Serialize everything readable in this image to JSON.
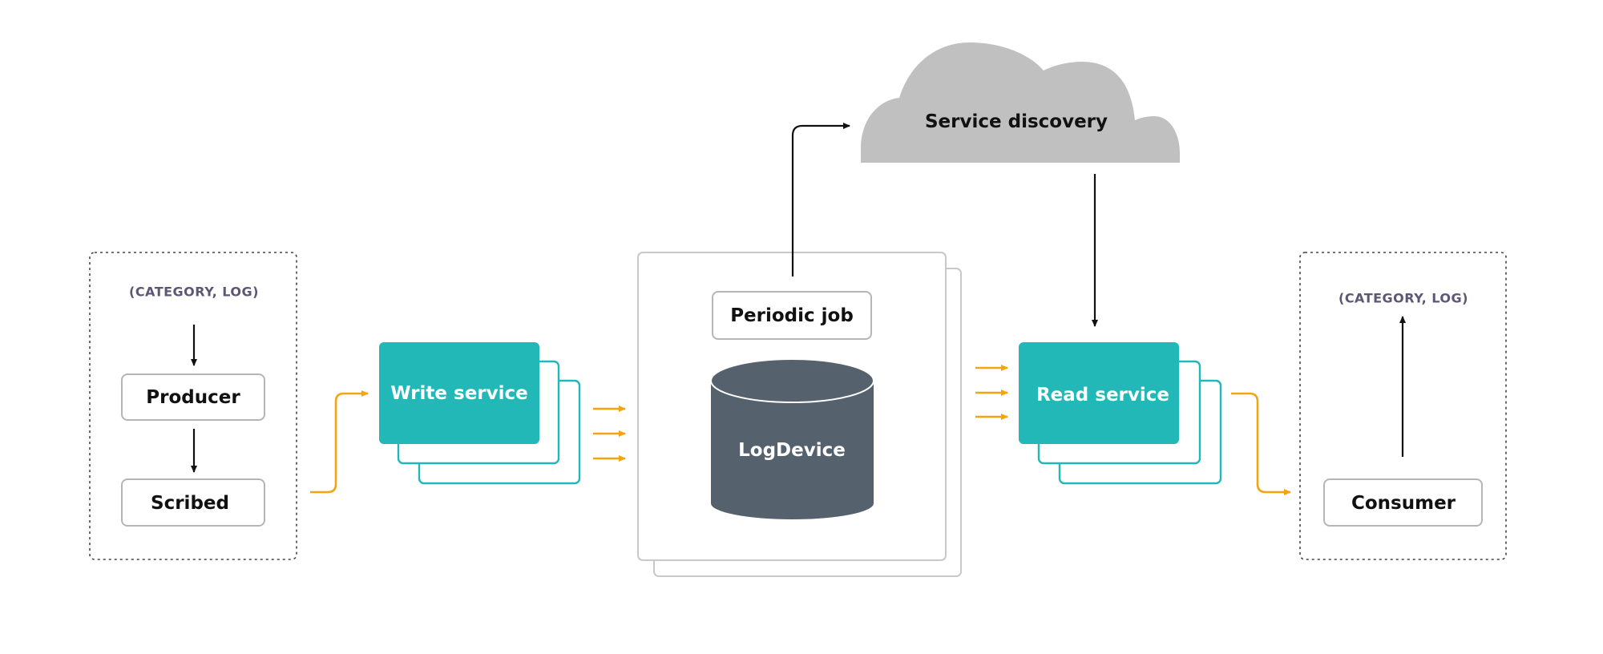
{
  "colors": {
    "service_teal": "#21b8b7",
    "flow_orange": "#f5a30f",
    "storage_slate": "#56616e",
    "cloud_gray": "#c0c0c0",
    "category_label": "#5e5677"
  },
  "producer_side": {
    "category_label": "(CATEGORY, LOG)",
    "producer": "Producer",
    "scribed": "Scribed"
  },
  "write_service": {
    "label": "Write service"
  },
  "storage": {
    "periodic_job": "Periodic job",
    "logdevice": "LogDevice"
  },
  "service_discovery": {
    "label": "Service discovery"
  },
  "read_service": {
    "label": "Read service"
  },
  "consumer_side": {
    "category_label": "(CATEGORY, LOG)",
    "consumer": "Consumer"
  }
}
